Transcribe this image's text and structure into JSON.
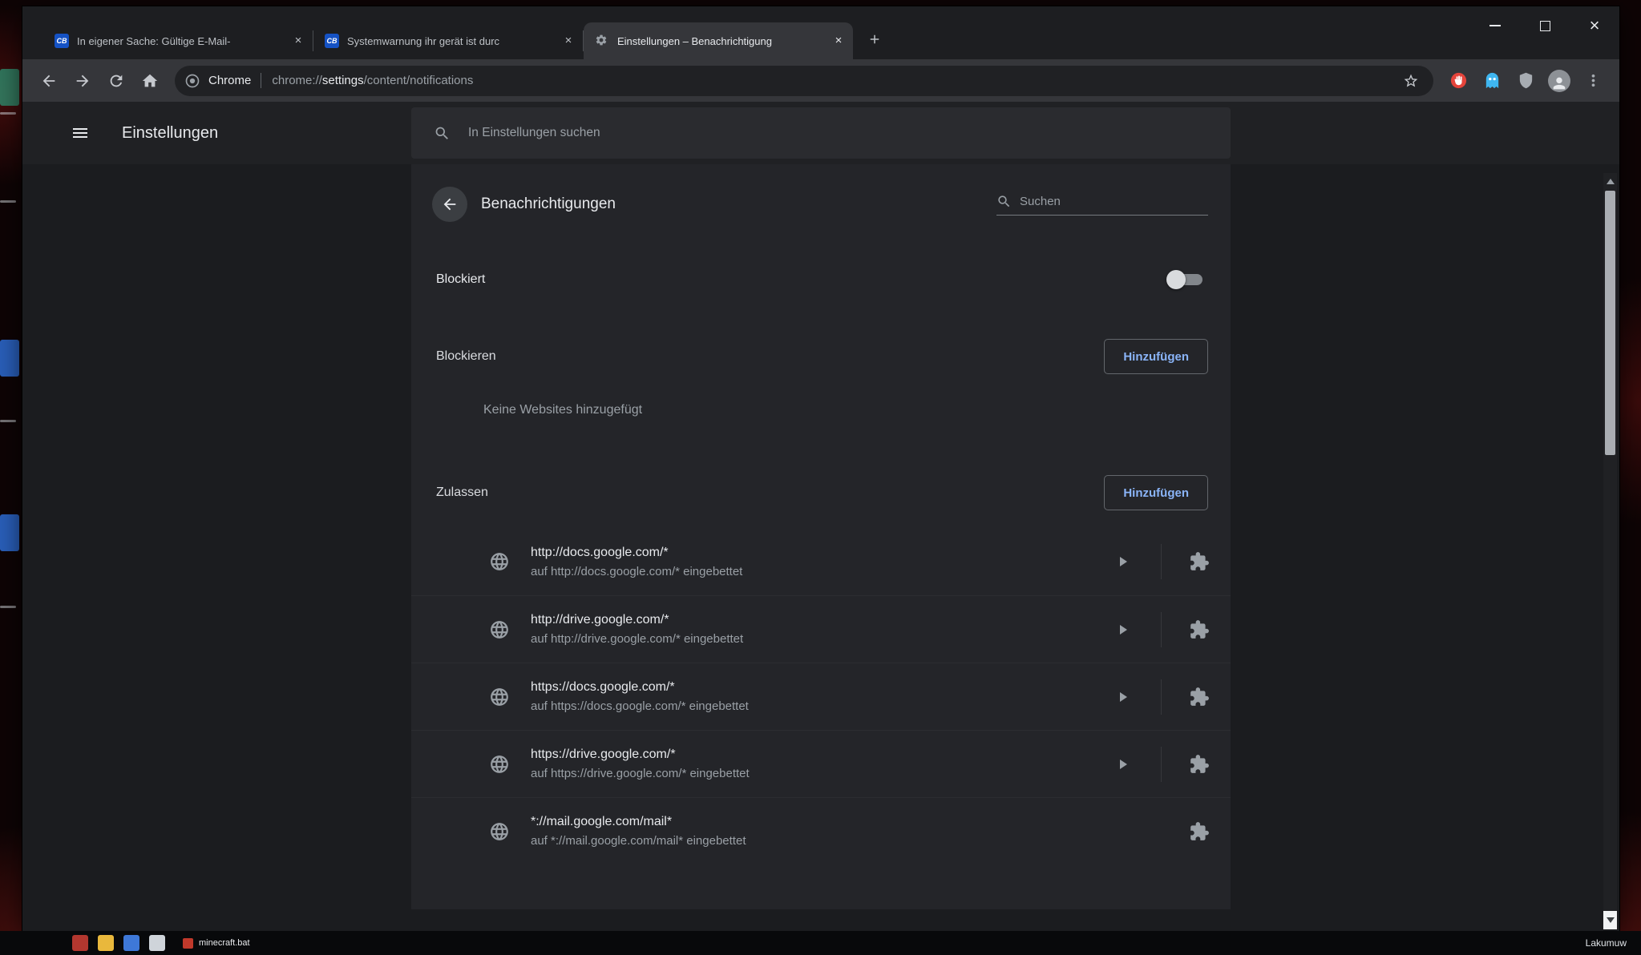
{
  "browser": {
    "tabs": [
      {
        "title": "In eigener Sache: Gültige E-Mail-",
        "favicon_text": "CB"
      },
      {
        "title": "Systemwarnung ihr gerät ist durc",
        "favicon_text": "CB"
      },
      {
        "title": "Einstellungen – Benachrichtigung"
      }
    ],
    "omnibox": {
      "brand": "Chrome",
      "url_scheme": "chrome://",
      "url_highlight": "settings",
      "url_rest": "/content/notifications"
    }
  },
  "settings": {
    "menu_title": "Einstellungen",
    "search_placeholder": "In Einstellungen suchen"
  },
  "page": {
    "title": "Benachrichtigungen",
    "search_placeholder": "Suchen",
    "toggle_label": "Blockiert",
    "toggle_state": "off",
    "block_section": {
      "label": "Blockieren",
      "add_button": "Hinzufügen",
      "empty": "Keine Websites hinzugefügt"
    },
    "allow_section": {
      "label": "Zulassen",
      "add_button": "Hinzufügen"
    },
    "sites": [
      {
        "url": "http://docs.google.com/*",
        "embedded": "auf http://docs.google.com/* eingebettet"
      },
      {
        "url": "http://drive.google.com/*",
        "embedded": "auf http://drive.google.com/* eingebettet"
      },
      {
        "url": "https://docs.google.com/*",
        "embedded": "auf https://docs.google.com/* eingebettet"
      },
      {
        "url": "https://drive.google.com/*",
        "embedded": "auf https://drive.google.com/* eingebettet"
      },
      {
        "url": "*://mail.google.com/mail*",
        "embedded": "auf *://mail.google.com/mail* eingebettet"
      }
    ]
  },
  "taskbar": {
    "item_label": "minecraft.bat",
    "right_label": "Lakumuw"
  },
  "colors": {
    "accent_blue": "#8ab4f8",
    "toolbar": "#35363a",
    "page_bg": "#202124",
    "text_primary": "#e8eaed",
    "text_secondary": "#9aa0a6"
  },
  "icons": {
    "gear-icon": "settings gear",
    "globe-icon": "website globe",
    "puzzle-icon": "extension puzzle piece",
    "search-icon": "magnifier",
    "star-icon": "bookmark star outline"
  }
}
